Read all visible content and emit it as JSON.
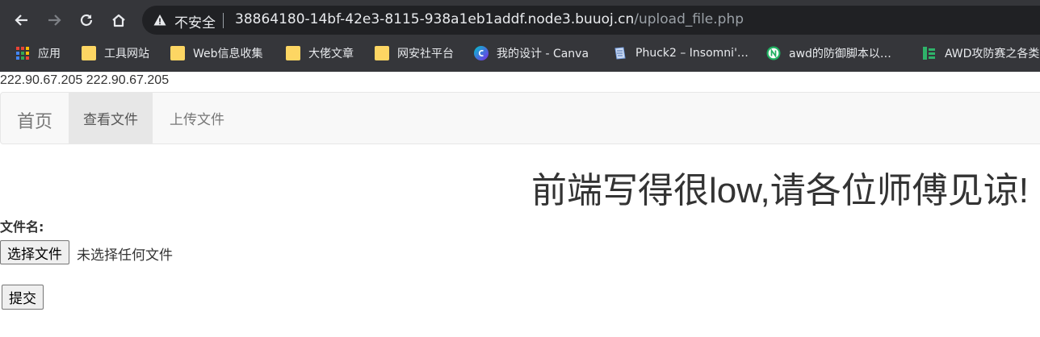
{
  "browser": {
    "security_label": "不安全",
    "url_host": "38864180-14bf-42e3-8115-938a1eb1addf.node3.buuoj.cn",
    "url_path": "/upload_file.php",
    "bookmarks": [
      "应用",
      "工具网站",
      "Web信息收集",
      "大佬文章",
      "网安社平台",
      "我的设计 - Canva",
      "Phuck2 – Insomni'…",
      "awd的防御脚本以…",
      "AWD攻防赛之各类"
    ]
  },
  "page": {
    "ip_text": "222.90.67.205 222.90.67.205",
    "nav": {
      "brand": "首页",
      "items": [
        "查看文件",
        "上传文件"
      ]
    },
    "heading": "前端写得很low,请各位师傅见谅!",
    "form": {
      "label": "文件名:",
      "choose_button": "选择文件",
      "file_status": "未选择任何文件",
      "submit_button": "提交"
    }
  }
}
